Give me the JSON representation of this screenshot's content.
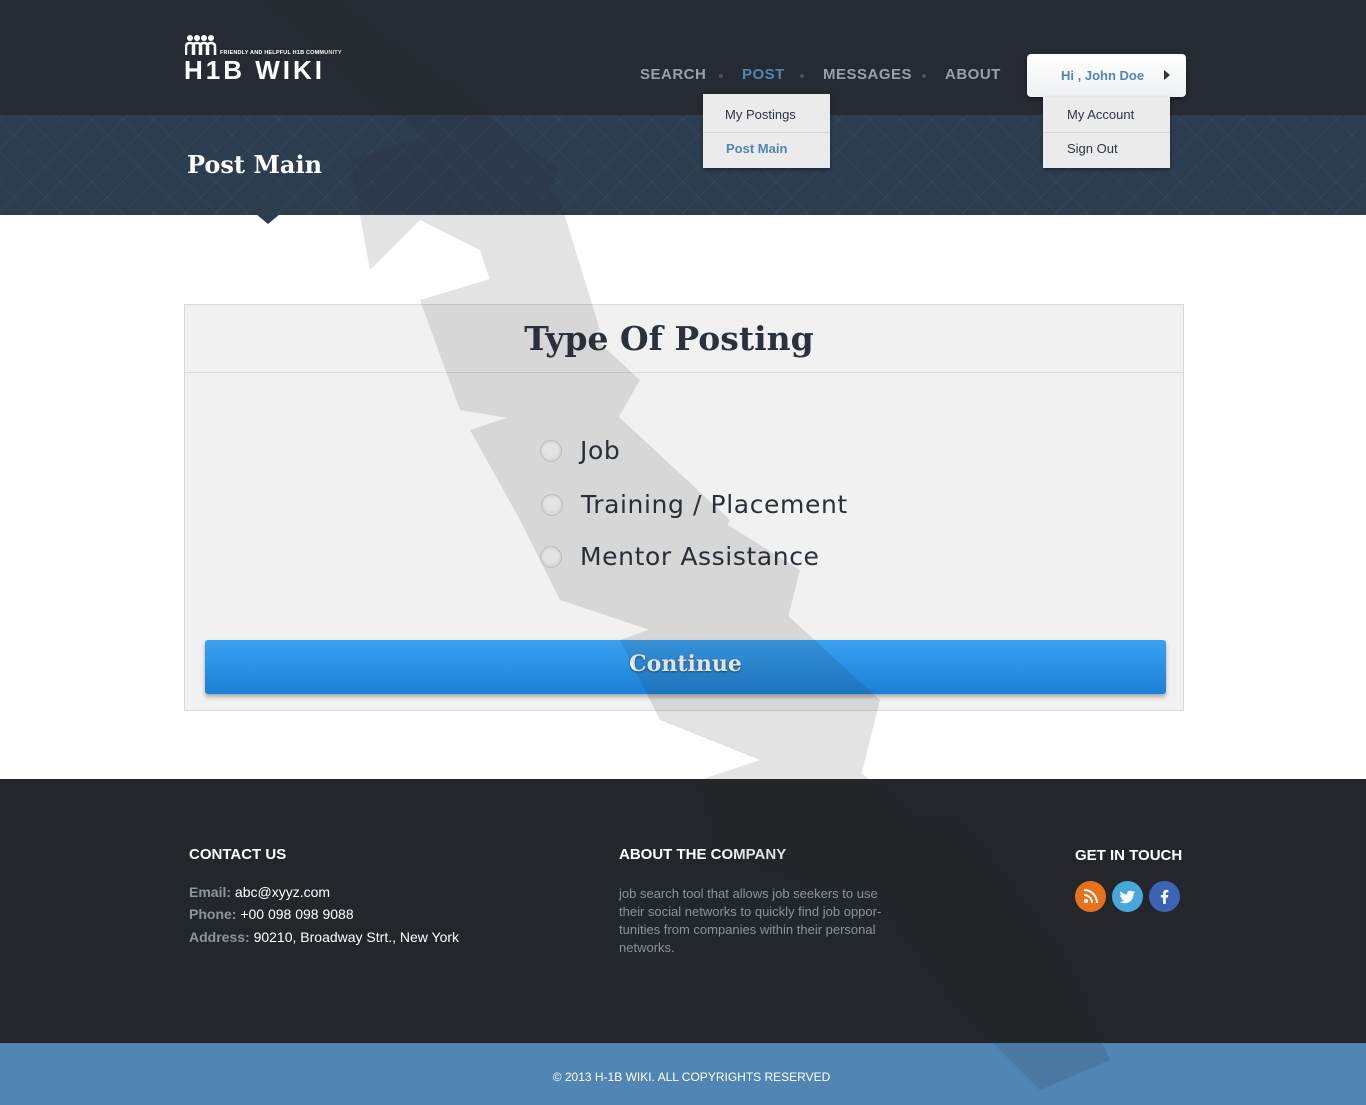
{
  "header": {
    "logo": {
      "tagline": "FRIENDLY AND HELPFUL H1B COMMUNITY",
      "wordmark": "H1B WIKI"
    },
    "nav": [
      {
        "label": "SEARCH",
        "active": false
      },
      {
        "label": "POST",
        "active": true
      },
      {
        "label": "MESSAGES",
        "active": false
      },
      {
        "label": "ABOUT",
        "active": false
      }
    ],
    "user_menu": {
      "label": "Hi , John Doe",
      "items": [
        "My Account",
        "Sign Out"
      ]
    },
    "post_menu": {
      "items": [
        "My Postings",
        "Post Main"
      ],
      "selected": "Post Main"
    }
  },
  "banner": {
    "title": "Post Main"
  },
  "form": {
    "title": "Type Of Posting",
    "options": [
      "Job",
      "Training / Placement",
      "Mentor Assistance"
    ],
    "submit_label": "Continue"
  },
  "footer": {
    "contact": {
      "heading": "CONTACT US",
      "email_label": "Email:",
      "email": "abc@xyyz.com",
      "phone_label": "Phone:",
      "phone": "+00 098 098 9088",
      "address_label": "Address:",
      "address": "90210, Broadway Strt., New York"
    },
    "about": {
      "heading": "ABOUT THE COMPANY",
      "lines": [
        "job search tool that allows job seekers to use",
        "their social networks to quickly find job oppor-",
        "tunities from companies within their personal",
        "networks."
      ]
    },
    "social": {
      "heading": "GET IN TOUCH",
      "icons": [
        "rss-icon",
        "twitter-icon",
        "facebook-icon"
      ],
      "colors": {
        "rss": "#e8711c",
        "twitter": "#47a7d8",
        "facebook": "#3c64b4"
      }
    },
    "copyright": "© 2013 H-1B WIKI. ALL COPYRIGHTS RESERVED"
  },
  "colors": {
    "accent": "#4f86b5",
    "button": "#2a91e4",
    "header_bg": "#262b33",
    "footer_bg": "#23272b",
    "copyright_bg": "#5185b3"
  }
}
